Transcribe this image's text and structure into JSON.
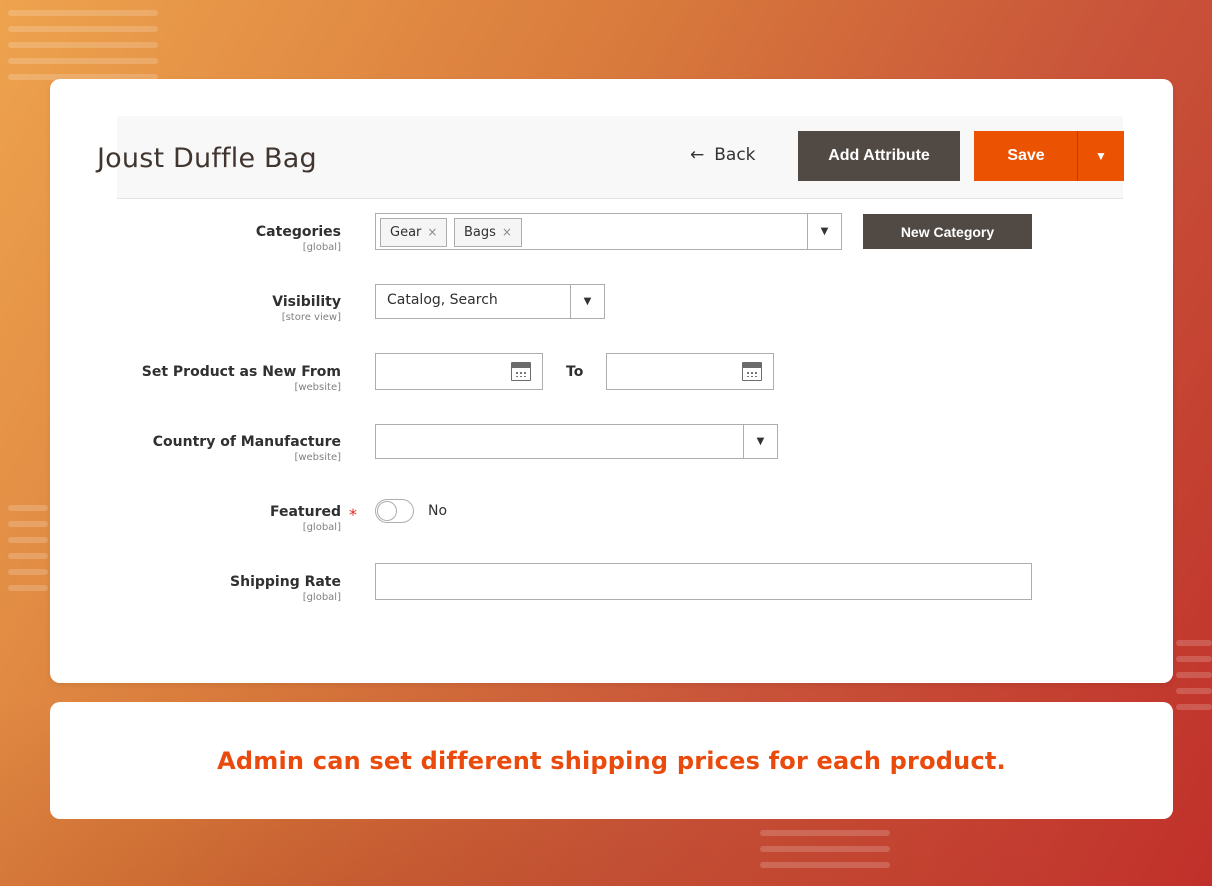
{
  "header": {
    "title": "Joust Duffle Bag",
    "back_label": "Back",
    "add_attribute_label": "Add Attribute",
    "save_label": "Save"
  },
  "fields": {
    "categories": {
      "label": "Categories",
      "scope": "[global]",
      "chips": [
        "Gear",
        "Bags"
      ],
      "new_category_label": "New Category"
    },
    "visibility": {
      "label": "Visibility",
      "scope": "[store view]",
      "value": "Catalog, Search"
    },
    "new_from": {
      "label": "Set Product as New From",
      "scope": "[website]",
      "from_value": "",
      "to_label": "To",
      "to_value": ""
    },
    "country": {
      "label": "Country of Manufacture",
      "scope": "[website]",
      "value": ""
    },
    "featured": {
      "label": "Featured",
      "scope": "[global]",
      "required_mark": "*",
      "toggle_text": "No",
      "enabled": false
    },
    "shipping_rate": {
      "label": "Shipping Rate",
      "scope": "[global]",
      "value": ""
    }
  },
  "banner": {
    "text": "Admin can set different shipping prices for each product."
  },
  "icons": {
    "back": "arrow-left-icon",
    "dropdown": "caret-down-icon",
    "calendar": "calendar-icon",
    "chip_remove": "close-icon"
  },
  "colors": {
    "primary": "#eb5202",
    "secondary": "#514943",
    "banner_text": "#eb4a0d"
  }
}
